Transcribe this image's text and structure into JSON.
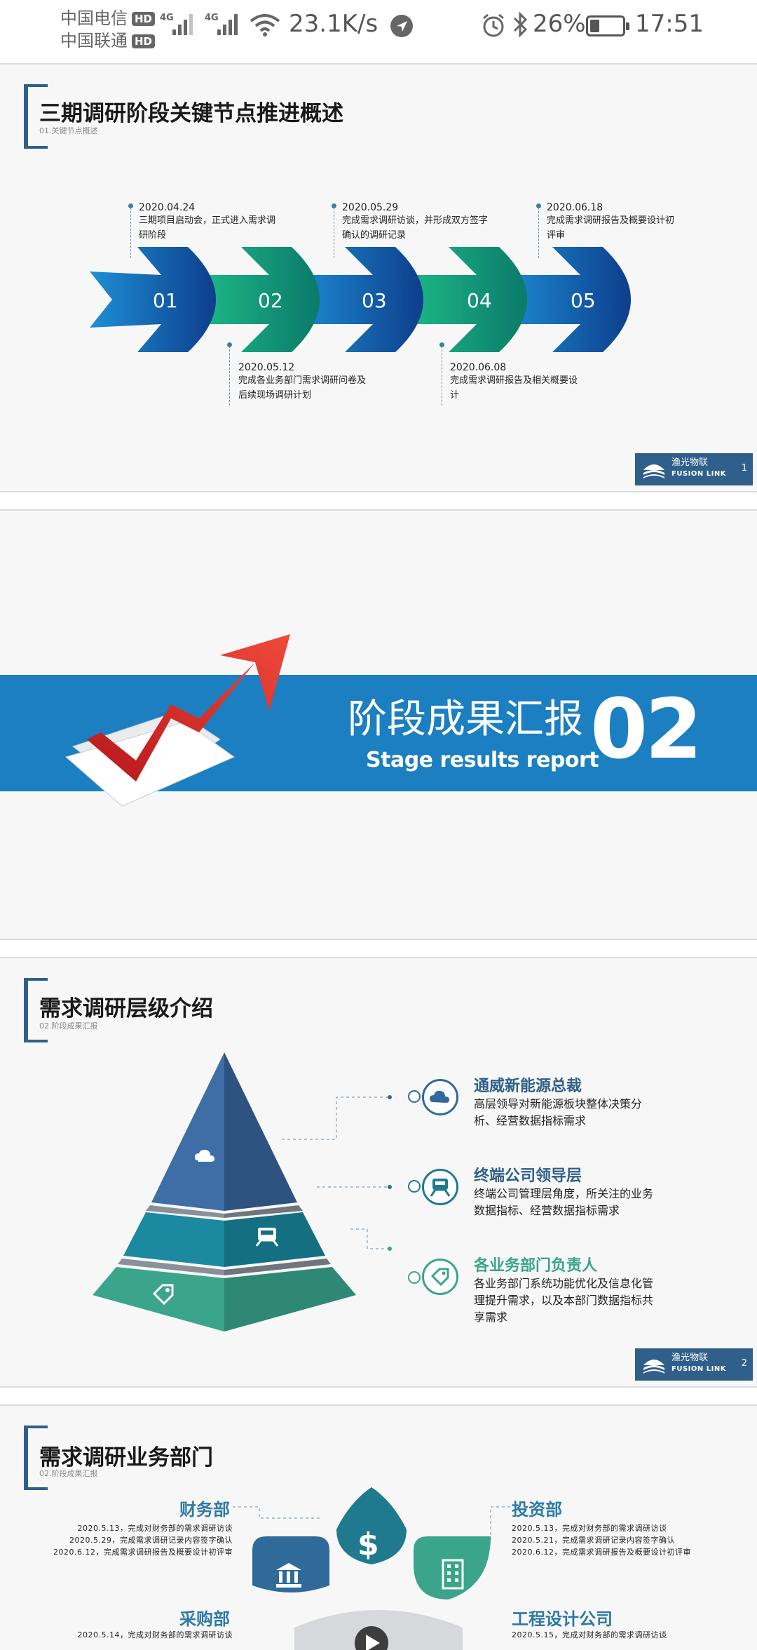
{
  "status_bar": {
    "carrier1": "中国电信",
    "carrier2": "中国联通",
    "hd": "HD",
    "net": "4G",
    "speed": "23.1K/s",
    "battery": "26%",
    "time": "17:51"
  },
  "slide1": {
    "title": "三期调研阶段关键节点推进概述",
    "subtitle": "01.关键节点概述",
    "arrows": [
      "01",
      "02",
      "03",
      "04",
      "05"
    ],
    "milestones": [
      {
        "date": "2020.04.24",
        "desc": "三期项目启动会，正式进入需求调研阶段"
      },
      {
        "date": "2020.05.12",
        "desc": "完成各业务部门需求调研问卷及后续现场调研计划"
      },
      {
        "date": "2020.05.29",
        "desc": "完成需求调研访谈，并形成双方签字确认的调研记录"
      },
      {
        "date": "2020.06.08",
        "desc": "完成需求调研报告及相关概要设计"
      },
      {
        "date": "2020.06.18",
        "desc": "完成需求调研报告及概要设计初评审"
      }
    ],
    "page": "1"
  },
  "brand": {
    "cn": "渔光物联",
    "en": "FUSION LINK"
  },
  "slide2": {
    "title_cn": "阶段成果汇报",
    "title_en": "Stage results report",
    "number": "02"
  },
  "slide3": {
    "title": "需求调研层级介绍",
    "subtitle": "02.阶段成果汇报",
    "levels": [
      {
        "title": "通威新能源总裁",
        "desc": "高层领导对新能源板块整体决策分析、经营数据指标需求",
        "icon": "cloud-icon"
      },
      {
        "title": "终端公司领导层",
        "desc": "终端公司管理层角度，所关注的业务数据指标、经营数据指标需求",
        "icon": "train-icon"
      },
      {
        "title": "各业务部门负责人",
        "desc": "各业务部门系统功能优化及信息化管理提升需求，以及本部门数据指标共享需求",
        "icon": "tag-icon"
      }
    ],
    "page": "2"
  },
  "slide4": {
    "title": "需求调研业务部门",
    "subtitle": "02.阶段成果汇报",
    "depts": [
      {
        "name": "财务部",
        "lines": [
          "2020.5.13，完成对财务部的需求调研访谈",
          "2020.5.29，完成需求调研记录内容签字确认",
          "2020.6.12，完成需求调研报告及概要设计初评审"
        ]
      },
      {
        "name": "投资部",
        "lines": [
          "2020.5.13，完成对财务部的需求调研访谈",
          "2020.5.21，完成需求调研记录内容签字确认",
          "2020.6.12，完成需求调研报告及概要设计初评审"
        ]
      },
      {
        "name": "采购部",
        "lines": [
          "2020.5.14，完成对财务部的需求调研访谈"
        ]
      },
      {
        "name": "工程设计公司",
        "lines": [
          "2020.5.15，完成对财务部的需求调研访谈"
        ]
      }
    ]
  }
}
